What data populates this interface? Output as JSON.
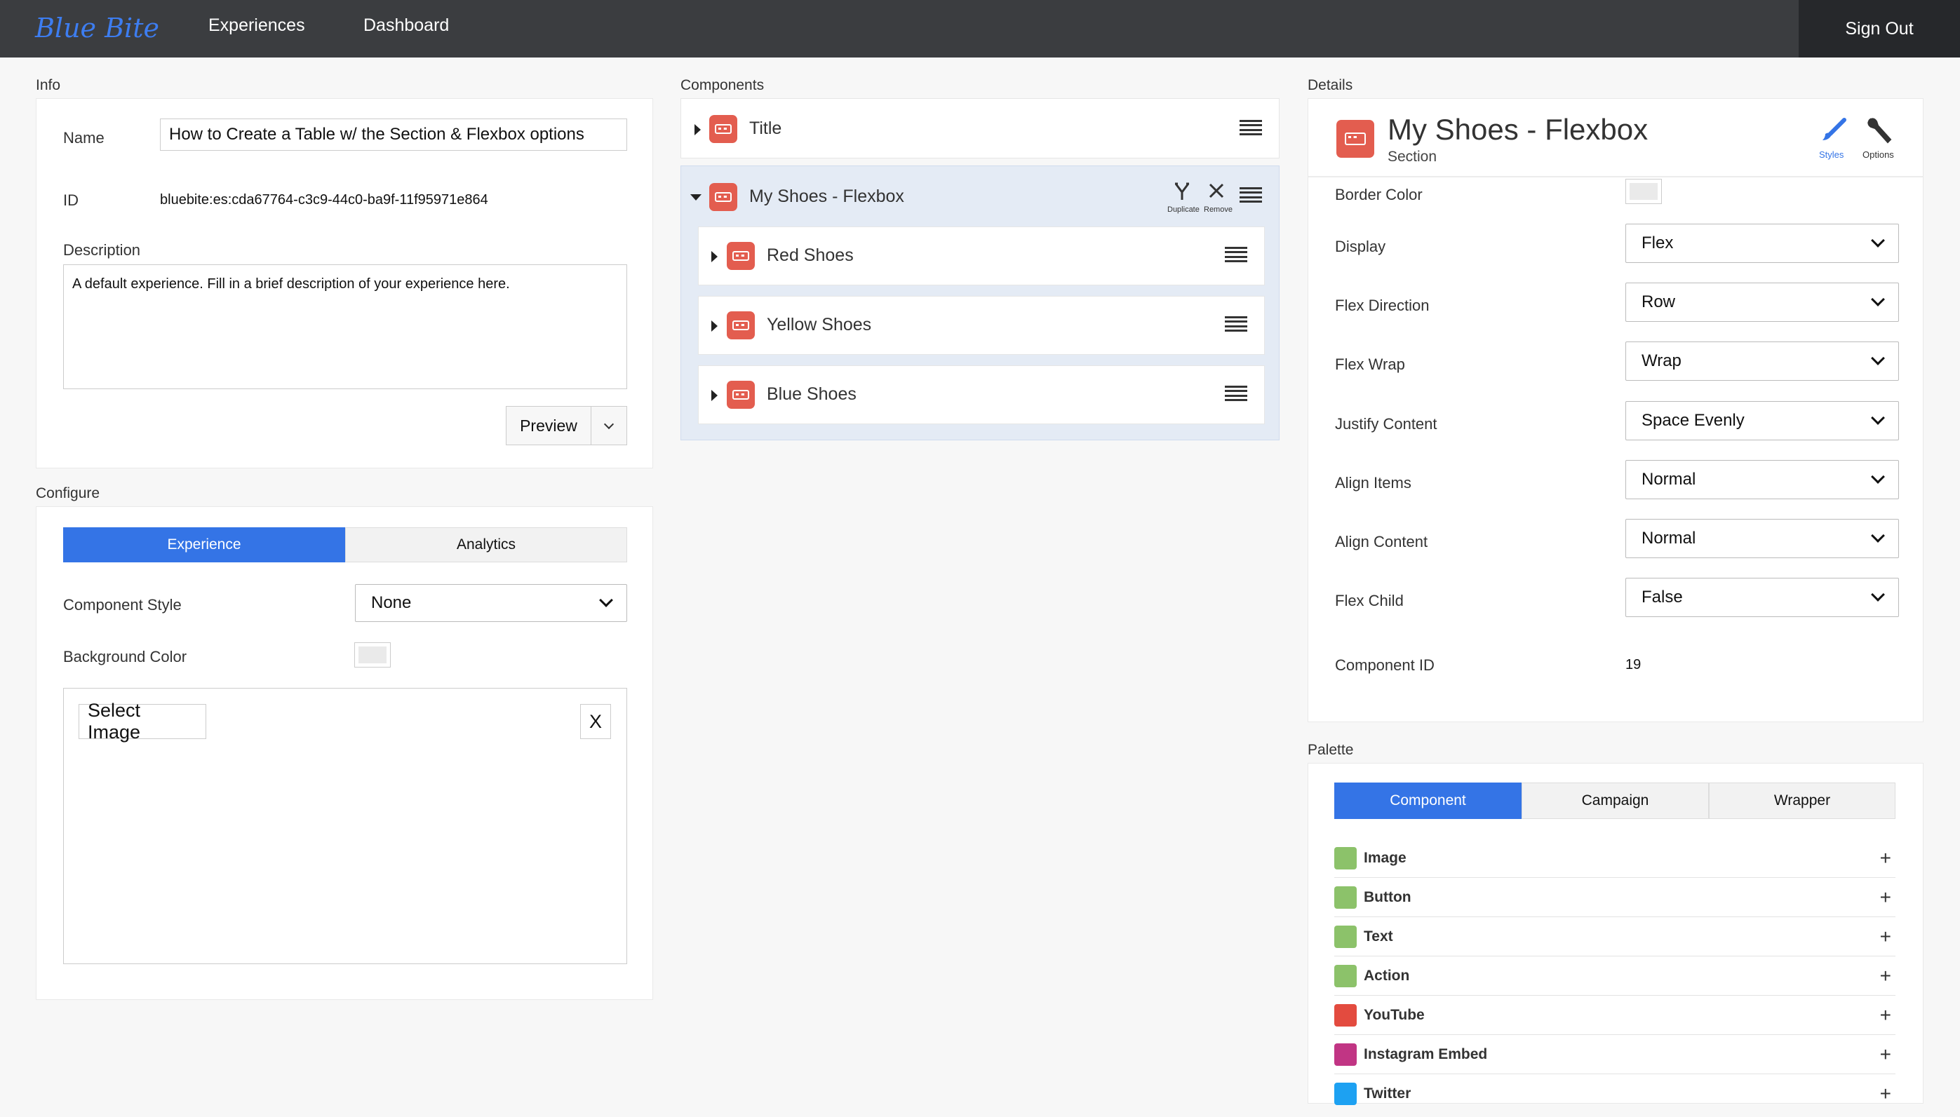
{
  "nav": {
    "logo": "Blue Bite",
    "items": [
      "Experiences",
      "Dashboard"
    ],
    "signout": "Sign Out"
  },
  "info": {
    "section_label": "Info",
    "name_label": "Name",
    "name_value": "How to Create a Table w/ the Section & Flexbox options",
    "id_label": "ID",
    "id_value": "bluebite:es:cda67764-c3c9-44c0-ba9f-11f95971e864",
    "description_label": "Description",
    "description_value": "A default experience. Fill in a brief description of your experience here.",
    "preview_label": "Preview"
  },
  "configure": {
    "section_label": "Configure",
    "tabs": [
      "Experience",
      "Analytics"
    ],
    "component_style_label": "Component Style",
    "component_style_value": "None",
    "background_color_label": "Background Color",
    "select_image_label": "Select Image",
    "clear_label": "X"
  },
  "components": {
    "section_label": "Components",
    "title_row": "Title",
    "section_row": "My Shoes - Flexbox",
    "duplicate_label": "Duplicate",
    "remove_label": "Remove",
    "children": [
      "Red Shoes",
      "Yellow Shoes",
      "Blue Shoes"
    ]
  },
  "details": {
    "section_label": "Details",
    "title": "My Shoes - Flexbox",
    "subtitle": "Section",
    "styles_label": "Styles",
    "options_label": "Options",
    "border_color_label": "Border Color",
    "fields": [
      {
        "label": "Display",
        "value": "Flex"
      },
      {
        "label": "Flex Direction",
        "value": "Row"
      },
      {
        "label": "Flex Wrap",
        "value": "Wrap"
      },
      {
        "label": "Justify Content",
        "value": "Space Evenly"
      },
      {
        "label": "Align Items",
        "value": "Normal"
      },
      {
        "label": "Align Content",
        "value": "Normal"
      },
      {
        "label": "Flex Child",
        "value": "False"
      }
    ],
    "component_id_label": "Component ID",
    "component_id_value": "19"
  },
  "palette": {
    "section_label": "Palette",
    "tabs": [
      "Component",
      "Campaign",
      "Wrapper"
    ],
    "items": [
      {
        "name": "Image",
        "icon": "image-icon",
        "color": "#8cc26a"
      },
      {
        "name": "Button",
        "icon": "button-icon",
        "color": "#8cc26a"
      },
      {
        "name": "Text",
        "icon": "text-icon",
        "color": "#8cc26a"
      },
      {
        "name": "Action",
        "icon": "action-icon",
        "color": "#8cc26a"
      },
      {
        "name": "YouTube",
        "icon": "youtube-icon",
        "color": "#e34b3f"
      },
      {
        "name": "Instagram Embed",
        "icon": "instagram-icon",
        "color": "#c13584"
      },
      {
        "name": "Twitter",
        "icon": "twitter-icon",
        "color": "#1da1f2"
      }
    ]
  },
  "colors": {
    "accent": "#3474e6",
    "nav_bg": "#3b3d40",
    "component_icon": "#e35d4f"
  }
}
